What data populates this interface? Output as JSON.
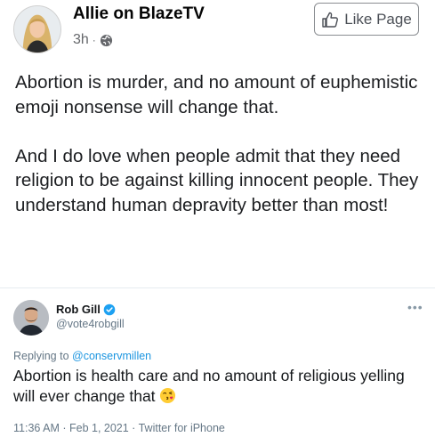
{
  "post": {
    "page_name": "Allie on BlazeTV",
    "time": "3h",
    "separator": "·",
    "like_button_label": "Like Page",
    "body": [
      "Abortion is murder, and no amount of euphemistic emoji nonsense will change that.",
      "And I do love when people admit that they need religion to be against killing innocent people. They understand human depravity better than most!"
    ],
    "icons": {
      "privacy": "globe-icon",
      "like": "thumbs-up-icon"
    }
  },
  "tweet": {
    "name": "Rob Gill",
    "handle": "@vote4robgill",
    "replying_prefix": "Replying to",
    "replying_to": "@conservmillen",
    "text": "Abortion is health care and no amount of religious yelling will ever change that",
    "emoji": "face-blowing-kiss-emoji",
    "meta": "11:36 AM · Feb 1, 2021 · Twitter for iPhone",
    "more": "•••",
    "icons": {
      "verified": "verified-badge-icon",
      "more": "more-options-icon"
    }
  },
  "colors": {
    "fb_text": "#1c1e21",
    "fb_secondary": "#65676b",
    "twitter_blue": "#1b95e0",
    "twitter_secondary": "#657786"
  }
}
